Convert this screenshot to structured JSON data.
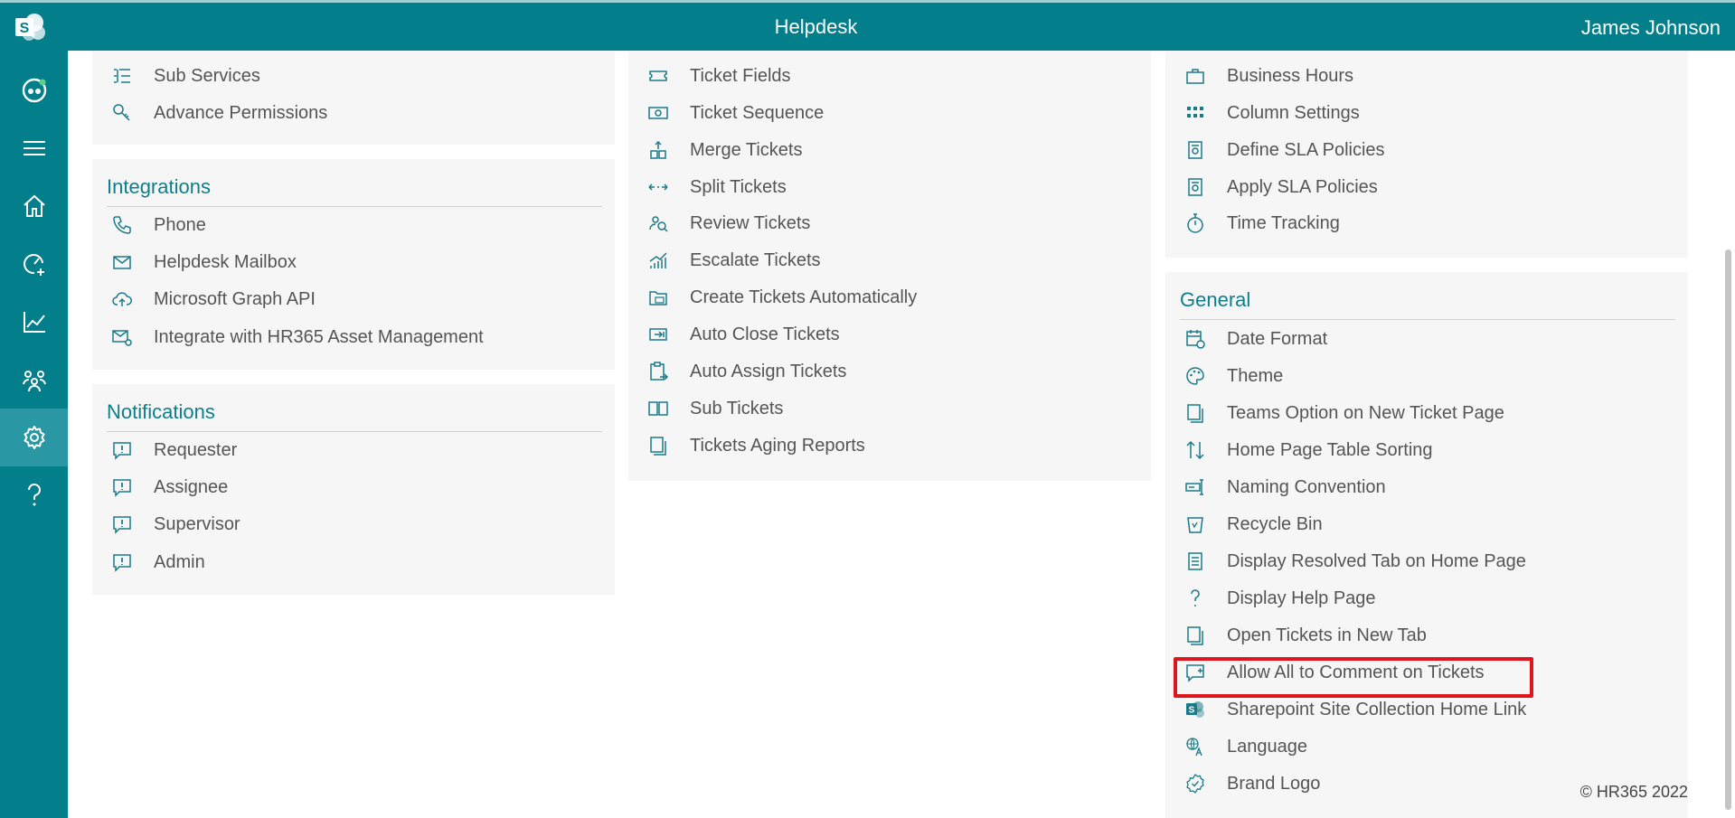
{
  "header": {
    "title": "Helpdesk",
    "user": "James Johnson"
  },
  "rail": {
    "items": [
      {
        "icon": "helpdesk-app-icon"
      },
      {
        "icon": "menu-icon"
      },
      {
        "icon": "home-icon"
      },
      {
        "icon": "dashboard-icon"
      },
      {
        "icon": "reports-icon"
      },
      {
        "icon": "users-icon"
      },
      {
        "icon": "settings-icon",
        "active": true
      },
      {
        "icon": "help-icon"
      }
    ]
  },
  "col1": {
    "top": [
      "Sub Services",
      "Advance Permissions"
    ],
    "integrations": {
      "title": "Integrations",
      "items": [
        "Phone",
        "Helpdesk Mailbox",
        "Microsoft Graph API",
        "Integrate with HR365 Asset Management"
      ]
    },
    "notifications": {
      "title": "Notifications",
      "items": [
        "Requester",
        "Assignee",
        "Supervisor",
        "Admin"
      ]
    }
  },
  "col2": {
    "items": [
      "Ticket Fields",
      "Ticket Sequence",
      "Merge Tickets",
      "Split Tickets",
      "Review Tickets",
      "Escalate Tickets",
      "Create Tickets Automatically",
      "Auto Close Tickets",
      "Auto Assign Tickets",
      "Sub Tickets",
      "Tickets Aging Reports"
    ]
  },
  "col3": {
    "top": [
      "Business Hours",
      "Column Settings",
      "Define SLA Policies",
      "Apply SLA Policies",
      "Time Tracking"
    ],
    "general": {
      "title": "General",
      "items": [
        "Date Format",
        "Theme",
        "Teams Option on New Ticket Page",
        "Home Page Table Sorting",
        "Naming Convention",
        "Recycle Bin",
        "Display Resolved Tab on Home Page",
        "Display Help Page",
        "Open Tickets in New Tab",
        "Allow All to Comment on Tickets",
        "Sharepoint Site Collection Home Link",
        "Language",
        "Brand Logo"
      ]
    }
  },
  "footer": {
    "copyright": "© HR365 2022"
  },
  "colors": {
    "brand": "#037f8c",
    "heading": "#0d7e8c",
    "highlight": "#e0151b"
  }
}
